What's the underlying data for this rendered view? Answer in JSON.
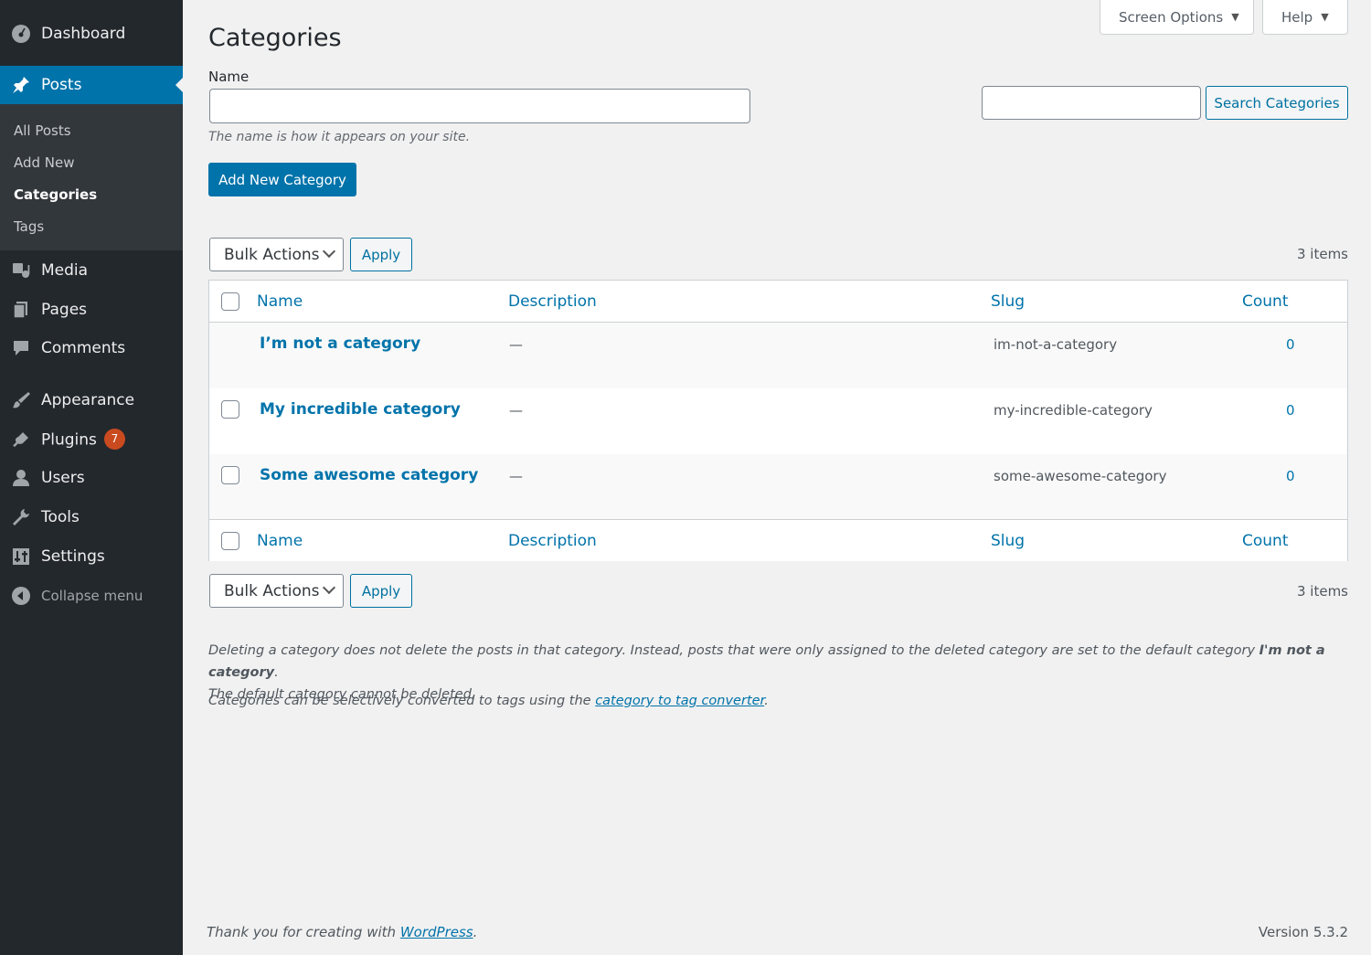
{
  "sidebar": {
    "dashboard": "Dashboard",
    "posts": "Posts",
    "submenu": {
      "all_posts": "All Posts",
      "add_new": "Add New",
      "categories": "Categories",
      "tags": "Tags"
    },
    "media": "Media",
    "pages": "Pages",
    "comments": "Comments",
    "appearance": "Appearance",
    "plugins": "Plugins",
    "plugins_badge": "7",
    "users": "Users",
    "tools": "Tools",
    "settings": "Settings",
    "collapse": "Collapse menu"
  },
  "header": {
    "screen_options": "Screen Options",
    "help": "Help",
    "title": "Categories"
  },
  "add_form": {
    "name_label": "Name",
    "name_value": "",
    "name_hint": "The name is how it appears on your site.",
    "submit": "Add New Category"
  },
  "search": {
    "value": "",
    "button": "Search Categories"
  },
  "bulk": {
    "select_label": "Bulk Actions",
    "apply": "Apply",
    "items_count": "3 items"
  },
  "table": {
    "columns": {
      "name": "Name",
      "description": "Description",
      "slug": "Slug",
      "count": "Count"
    },
    "rows": [
      {
        "name": "I’m not a category",
        "description": "—",
        "slug": "im-not-a-category",
        "count": "0"
      },
      {
        "name": "My incredible category",
        "description": "—",
        "slug": "my-incredible-category",
        "count": "0"
      },
      {
        "name": "Some awesome category",
        "description": "—",
        "slug": "some-awesome-category",
        "count": "0"
      }
    ]
  },
  "notes": {
    "delete_note_prefix": "Deleting a category does not delete the posts in that category. Instead, posts that were only assigned to the deleted category are set to the default category ",
    "default_category": "I'm not a category",
    "delete_note_suffix": ".",
    "delete_note_line2": "The default category cannot be deleted.",
    "convert_prefix": "Categories can be selectively converted to tags using the ",
    "convert_link": "category to tag converter",
    "convert_suffix": "."
  },
  "footer": {
    "thanks_prefix": "Thank you for creating with ",
    "thanks_link": "WordPress",
    "thanks_suffix": ".",
    "version": "Version 5.3.2"
  },
  "colors": {
    "sidebar_bg": "#23282d",
    "submenu_bg": "#32373c",
    "accent": "#0073aa",
    "badge": "#ca4a1f",
    "page_bg": "#f1f1f1"
  }
}
